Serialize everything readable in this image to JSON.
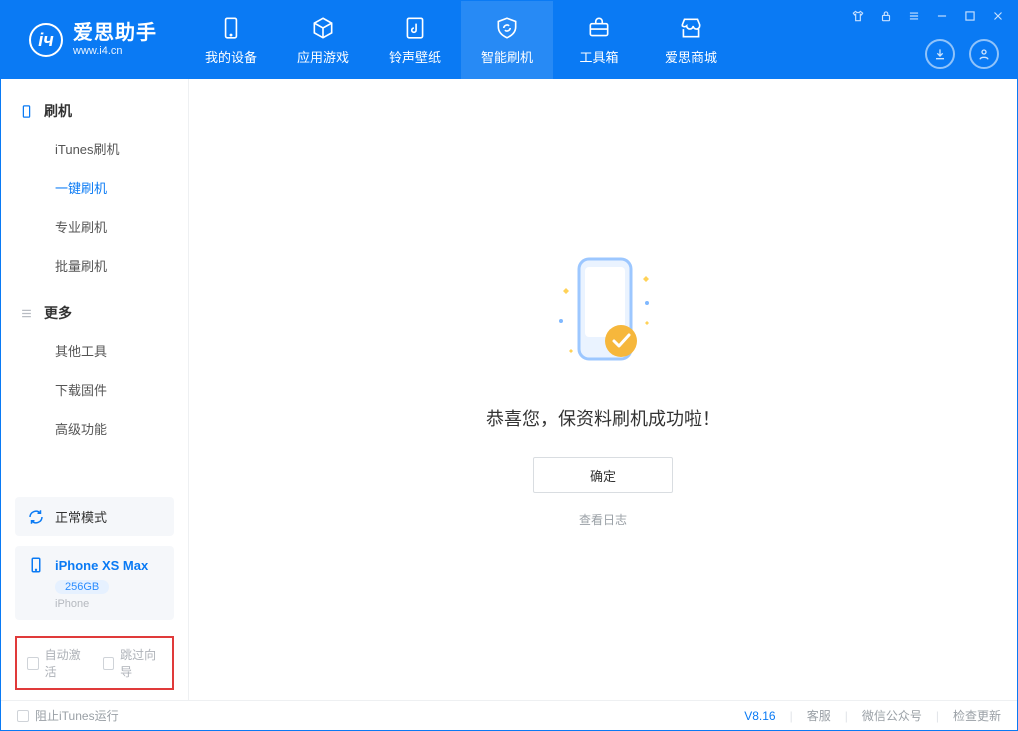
{
  "app": {
    "title": "爱思助手",
    "subtitle": "www.i4.cn"
  },
  "nav": {
    "items": [
      {
        "label": "我的设备"
      },
      {
        "label": "应用游戏"
      },
      {
        "label": "铃声壁纸"
      },
      {
        "label": "智能刷机"
      },
      {
        "label": "工具箱"
      },
      {
        "label": "爱思商城"
      }
    ]
  },
  "sidebar": {
    "section1": {
      "title": "刷机",
      "items": [
        "iTunes刷机",
        "一键刷机",
        "专业刷机",
        "批量刷机"
      ]
    },
    "section2": {
      "title": "更多",
      "items": [
        "其他工具",
        "下载固件",
        "高级功能"
      ]
    },
    "mode_label": "正常模式",
    "device": {
      "name": "iPhone XS Max",
      "capacity": "256GB",
      "type": "iPhone"
    },
    "checks": {
      "auto_activate": "自动激活",
      "skip_setup": "跳过向导"
    }
  },
  "main": {
    "success_text": "恭喜您，保资料刷机成功啦！",
    "confirm_label": "确定",
    "log_link": "查看日志"
  },
  "status": {
    "block_itunes": "阻止iTunes运行",
    "version": "V8.16",
    "links": [
      "客服",
      "微信公众号",
      "检查更新"
    ]
  }
}
